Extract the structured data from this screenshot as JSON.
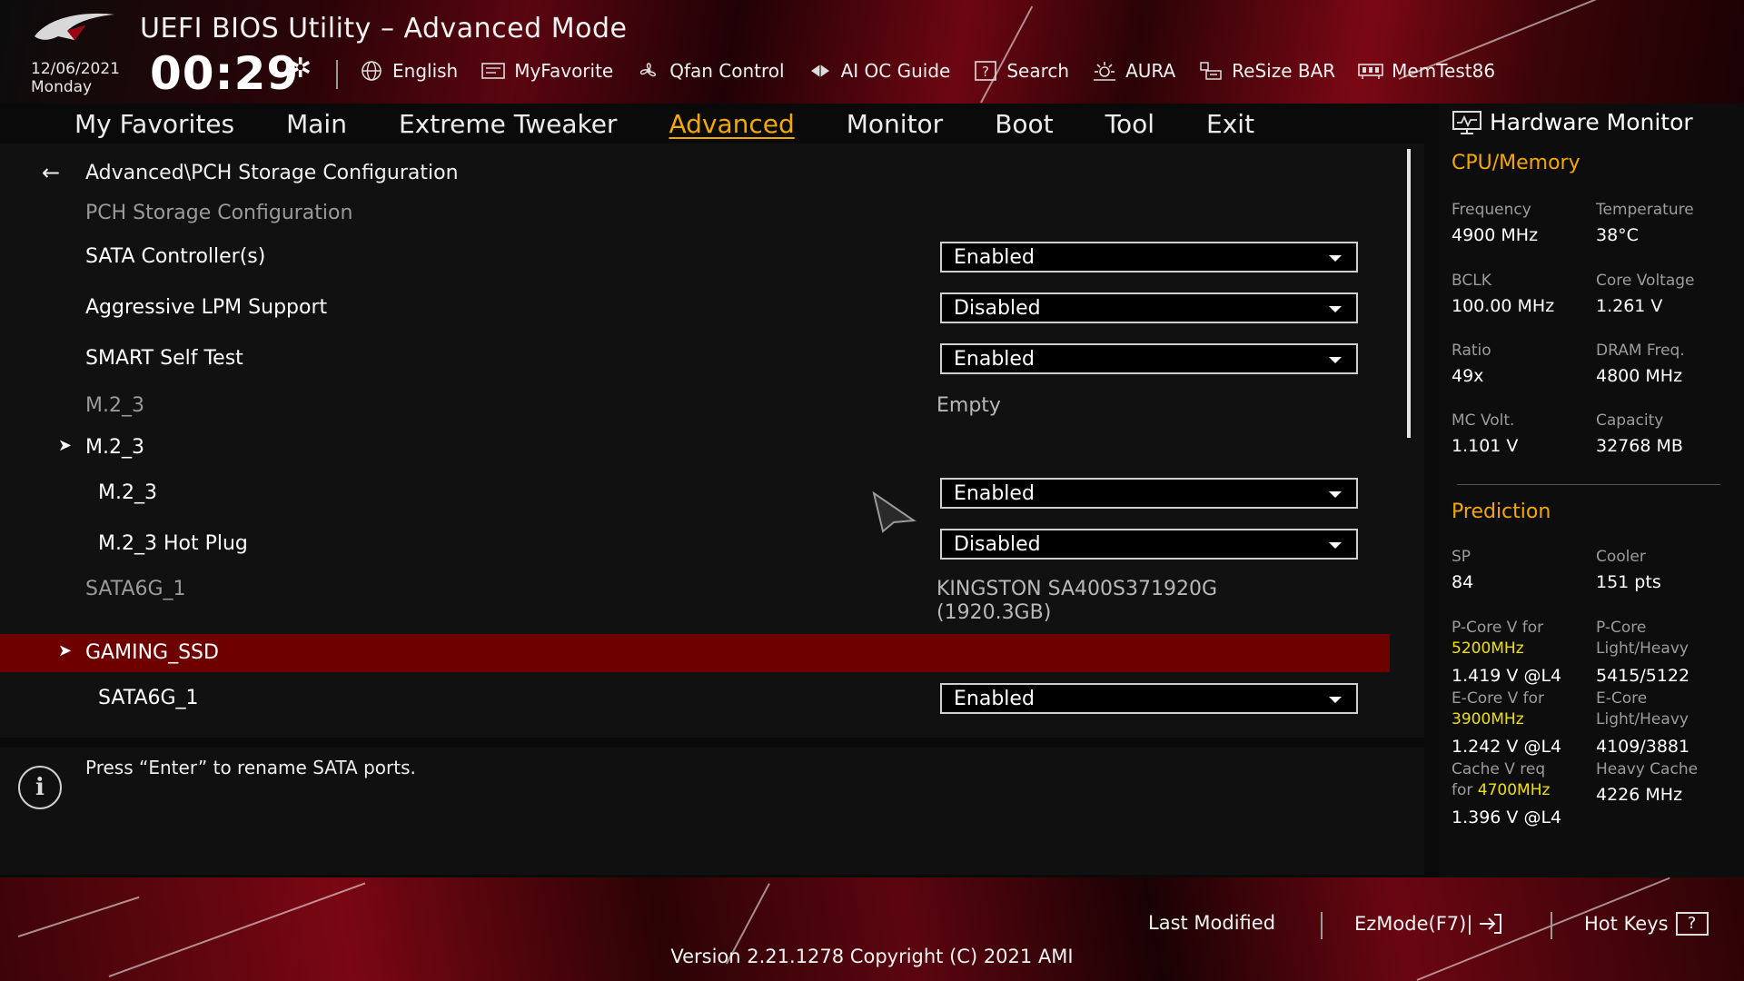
{
  "header": {
    "title": "UEFI BIOS Utility – Advanced Mode",
    "date": "12/06/2021",
    "day": "Monday",
    "time": "00:29"
  },
  "toolbar": [
    {
      "label": "English",
      "icon": "globe-icon"
    },
    {
      "label": "MyFavorite",
      "icon": "favorite-icon"
    },
    {
      "label": "Qfan Control",
      "icon": "fan-icon"
    },
    {
      "label": "AI OC Guide",
      "icon": "ai-icon"
    },
    {
      "label": "Search",
      "icon": "search-icon"
    },
    {
      "label": "AURA",
      "icon": "aura-icon"
    },
    {
      "label": "ReSize BAR",
      "icon": "resize-bar-icon"
    },
    {
      "label": "MemTest86",
      "icon": "memtest-icon"
    }
  ],
  "tabs": [
    {
      "label": "My Favorites"
    },
    {
      "label": "Main"
    },
    {
      "label": "Extreme Tweaker"
    },
    {
      "label": "Advanced",
      "active": true
    },
    {
      "label": "Monitor"
    },
    {
      "label": "Boot"
    },
    {
      "label": "Tool"
    },
    {
      "label": "Exit"
    }
  ],
  "main": {
    "breadcrumb": "Advanced\\PCH Storage Configuration",
    "rows": [
      {
        "label": "PCH Storage Configuration",
        "grey": true
      },
      {
        "label": "SATA Controller(s)",
        "dropdown": "Enabled"
      },
      {
        "label": "Aggressive LPM Support",
        "dropdown": "Disabled"
      },
      {
        "label": "SMART Self Test",
        "dropdown": "Enabled"
      },
      {
        "label": "M.2_3",
        "grey": true,
        "value": "Empty"
      },
      {
        "label": "M.2_3",
        "arrow": true
      },
      {
        "label": "M.2_3",
        "sub": true,
        "dropdown": "Enabled"
      },
      {
        "label": "M.2_3 Hot Plug",
        "sub": true,
        "dropdown": "Disabled"
      },
      {
        "label": "SATA6G_1",
        "grey": true,
        "value": "KINGSTON SA400S371920G",
        "value2": "(1920.3GB)"
      },
      {
        "label": "GAMING_SSD",
        "arrow": true,
        "selected": true
      },
      {
        "label": "SATA6G_1",
        "sub": true,
        "dropdown": "Enabled"
      }
    ]
  },
  "help": {
    "text": "Press “Enter” to rename SATA ports."
  },
  "hw": {
    "title": "Hardware Monitor",
    "cpu_section": "CPU/Memory",
    "cpu": [
      {
        "label": "Frequency",
        "value": "4900 MHz"
      },
      {
        "label": "Temperature",
        "value": "38°C"
      },
      {
        "label": "BCLK",
        "value": "100.00 MHz"
      },
      {
        "label": "Core Voltage",
        "value": "1.261 V"
      },
      {
        "label": "Ratio",
        "value": "49x"
      },
      {
        "label": "DRAM Freq.",
        "value": "4800 MHz"
      },
      {
        "label": "MC Volt.",
        "value": "1.101 V"
      },
      {
        "label": "Capacity",
        "value": "32768 MB"
      }
    ],
    "pred_section": "Prediction",
    "pred": {
      "sp_label": "SP",
      "sp_value": "84",
      "cooler_label": "Cooler",
      "cooler_value": "151 pts",
      "pcore_v_label": "P-Core V for",
      "pcore_v_freq": "5200MHz",
      "pcore_v_value": "1.419 V @L4",
      "pcore_lh_label1": "P-Core",
      "pcore_lh_label2": "Light/Heavy",
      "pcore_lh_value": "5415/5122",
      "ecore_v_label": "E-Core V for",
      "ecore_v_freq": "3900MHz",
      "ecore_v_value": "1.242 V @L4",
      "ecore_lh_label1": "E-Core",
      "ecore_lh_label2": "Light/Heavy",
      "ecore_lh_value": "4109/3881",
      "cache_label1": "Cache V req",
      "cache_label2": "for",
      "cache_freq": "4700MHz",
      "cache_value": "1.396 V @L4",
      "heavy_cache_label": "Heavy Cache",
      "heavy_cache_value": "4226 MHz"
    }
  },
  "footer": {
    "last_modified": "Last Modified",
    "ezmode": "EzMode(F7)|",
    "hotkeys": "Hot Keys",
    "version": "Version 2.21.1278 Copyright (C) 2021 AMI"
  },
  "colors": {
    "accent": "#f5a800",
    "selected_row": "#6e0000",
    "highlight_freq": "#f0e000"
  }
}
